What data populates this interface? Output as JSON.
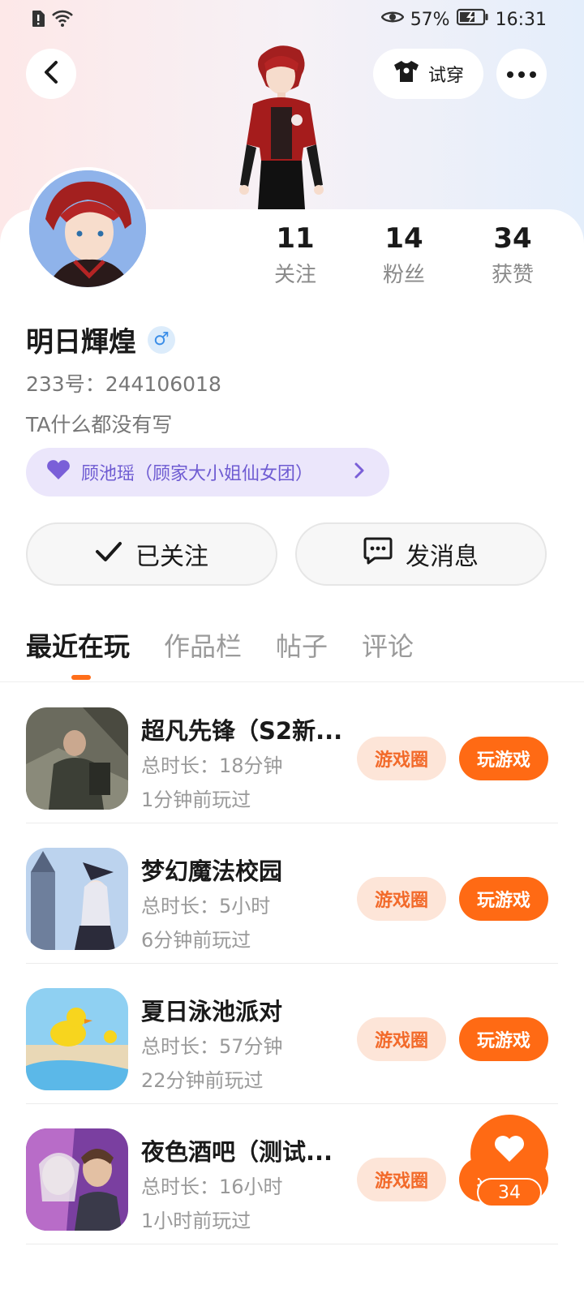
{
  "status_bar": {
    "battery_percent": "57%",
    "time": "16:31"
  },
  "header": {
    "try_on_label": "试穿"
  },
  "profile": {
    "stats": [
      {
        "value": "11",
        "label": "关注"
      },
      {
        "value": "14",
        "label": "粉丝"
      },
      {
        "value": "34",
        "label": "获赞"
      }
    ],
    "name": "明日輝煌",
    "gender_symbol": "♂",
    "id_line": "233号：244106018",
    "bio": "TA什么都没有写",
    "fan_pill": "顾池瑶（顾家大小姐仙女团）",
    "follow_button": "已关注",
    "message_button": "发消息"
  },
  "tabs": [
    {
      "label": "最近在玩",
      "active": true
    },
    {
      "label": "作品栏",
      "active": false
    },
    {
      "label": "帖子",
      "active": false
    },
    {
      "label": "评论",
      "active": false
    }
  ],
  "games": [
    {
      "title": "超凡先锋（S2新...",
      "duration": "总时长：18分钟",
      "last_played": "1分钟前玩过",
      "circle_label": "游戏圈",
      "play_label": "玩游戏"
    },
    {
      "title": "梦幻魔法校园",
      "duration": "总时长：5小时",
      "last_played": "6分钟前玩过",
      "circle_label": "游戏圈",
      "play_label": "玩游戏"
    },
    {
      "title": "夏日泳池派对",
      "duration": "总时长：57分钟",
      "last_played": "22分钟前玩过",
      "circle_label": "游戏圈",
      "play_label": "玩游戏"
    },
    {
      "title": "夜色酒吧（测试...",
      "duration": "总时长：16小时",
      "last_played": "1小时前玩过",
      "circle_label": "游戏圈",
      "play_label": "玩游戏"
    }
  ],
  "like_fab": {
    "count": "34"
  },
  "colors": {
    "accent": "#ff6a14",
    "pill_text": "#6e5bd2",
    "pill_bg": "#ebe6fb"
  },
  "icons": [
    "back-icon",
    "tshirt-icon",
    "more-icon",
    "heart-icon",
    "check-icon",
    "chat-bubble-icon",
    "chevron-right-icon",
    "eye-icon",
    "battery-icon",
    "wifi-icon",
    "sim-alert-icon"
  ]
}
